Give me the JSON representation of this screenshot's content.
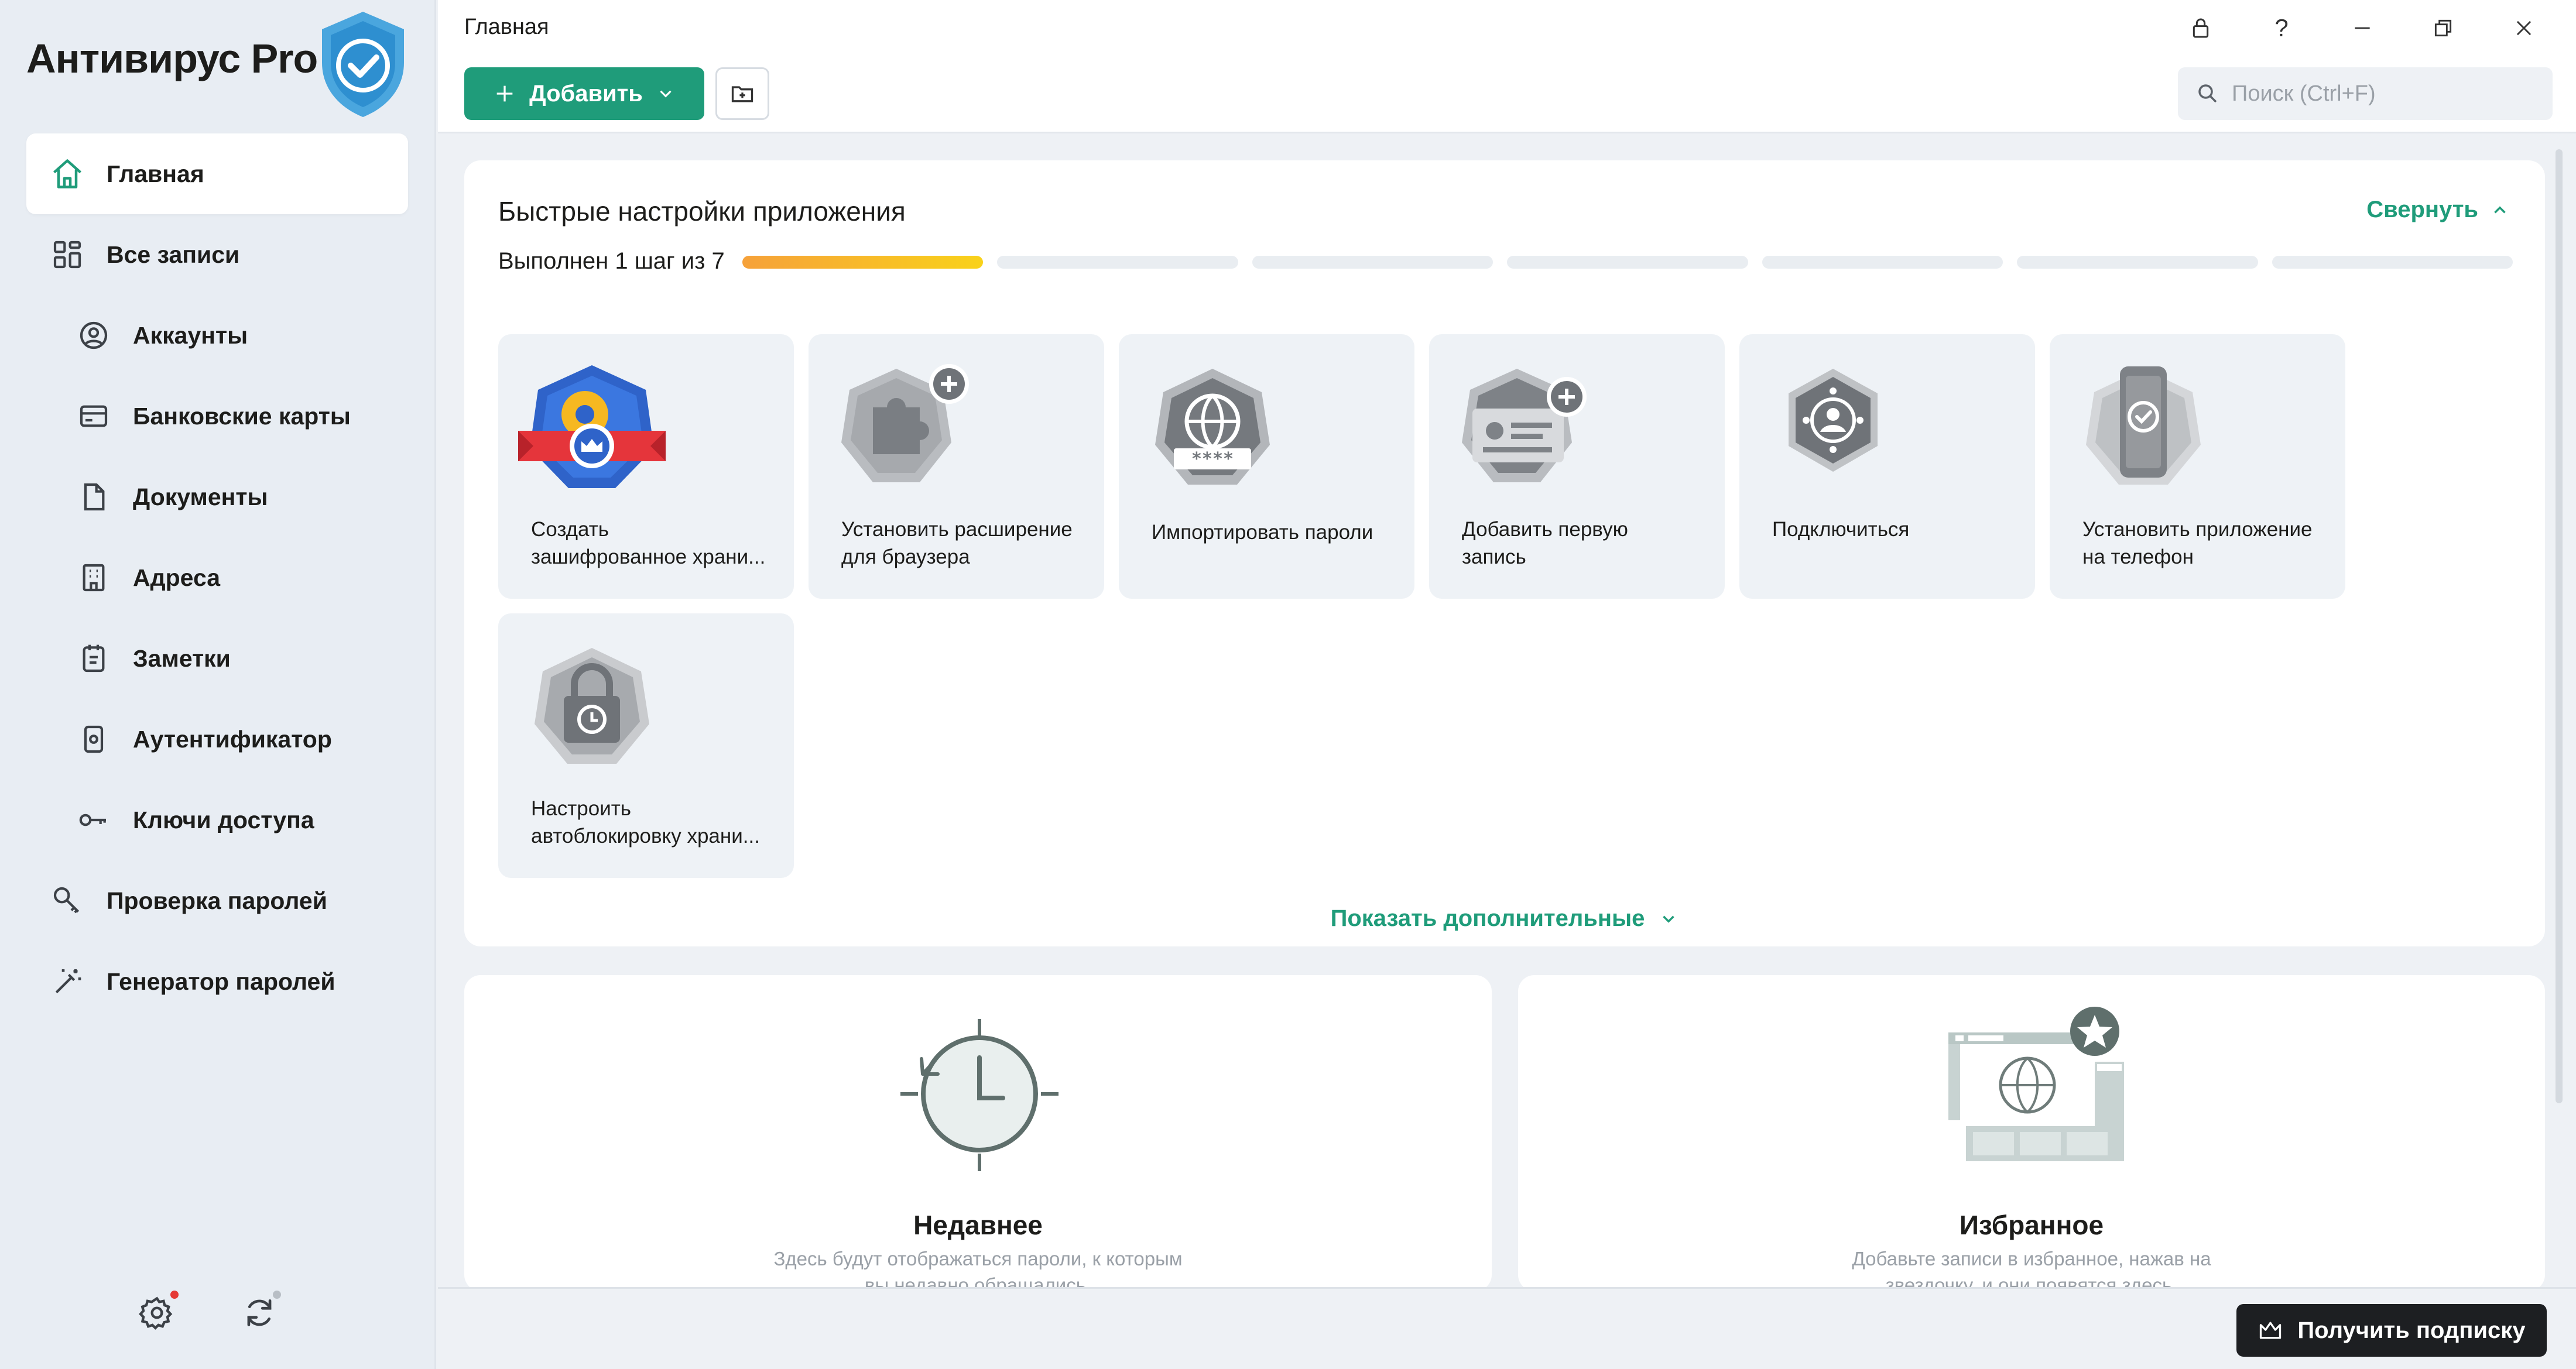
{
  "app": {
    "title": "Антивирус Pro"
  },
  "sidebar": {
    "items": [
      {
        "label": "Главная",
        "icon": "home-icon",
        "active": true,
        "sub": false
      },
      {
        "label": "Все записи",
        "icon": "grid-icon",
        "active": false,
        "sub": false
      },
      {
        "label": "Аккаунты",
        "icon": "user-icon",
        "active": false,
        "sub": true
      },
      {
        "label": "Банковские карты",
        "icon": "card-icon",
        "active": false,
        "sub": true
      },
      {
        "label": "Документы",
        "icon": "document-icon",
        "active": false,
        "sub": true
      },
      {
        "label": "Адреса",
        "icon": "building-icon",
        "active": false,
        "sub": true
      },
      {
        "label": "Заметки",
        "icon": "notepad-icon",
        "active": false,
        "sub": true
      },
      {
        "label": "Аутентификатор",
        "icon": "phone-icon",
        "active": false,
        "sub": true
      },
      {
        "label": "Ключи доступа",
        "icon": "key-icon",
        "active": false,
        "sub": true
      },
      {
        "label": "Проверка паролей",
        "icon": "key-search-icon",
        "active": false,
        "sub": false
      },
      {
        "label": "Генератор паролей",
        "icon": "magic-wand-icon",
        "active": false,
        "sub": false
      }
    ]
  },
  "header": {
    "breadcrumb": "Главная",
    "add_label": "Добавить",
    "search_placeholder": "Поиск (Ctrl+F)"
  },
  "quick_setup": {
    "title": "Быстрые настройки приложения",
    "collapse_label": "Свернуть",
    "progress_label": "Выполнен 1 шаг из 7",
    "steps_total": 7,
    "steps_done": 1,
    "tiles": [
      {
        "line1": "Создать",
        "line2": "зашифрованное храни..."
      },
      {
        "line1": "Установить расширение",
        "line2": "для браузера"
      },
      {
        "line1": "Импортировать пароли",
        "line2": ""
      },
      {
        "line1": "Добавить первую",
        "line2": "запись"
      },
      {
        "line1": "Подключиться",
        "line2": ""
      },
      {
        "line1": "Установить приложение",
        "line2": "на телефон"
      },
      {
        "line1": "Настроить",
        "line2": "автоблокировку храни..."
      }
    ],
    "show_more_label": "Показать дополнительные"
  },
  "recent": {
    "title": "Недавнее",
    "desc1": "Здесь будут отображаться пароли, к которым",
    "desc2": "вы недавно обращались."
  },
  "favorites": {
    "title": "Избранное",
    "desc1": "Добавьте записи в избранное, нажав на",
    "desc2": "звездочку, и они появятся здесь."
  },
  "footer": {
    "subscribe_label": "Получить подписку"
  },
  "colors": {
    "accent": "#1f9c7a",
    "progress_start": "#f6a13a",
    "progress_end": "#f9d21a",
    "notification_dot": "#e53935"
  }
}
